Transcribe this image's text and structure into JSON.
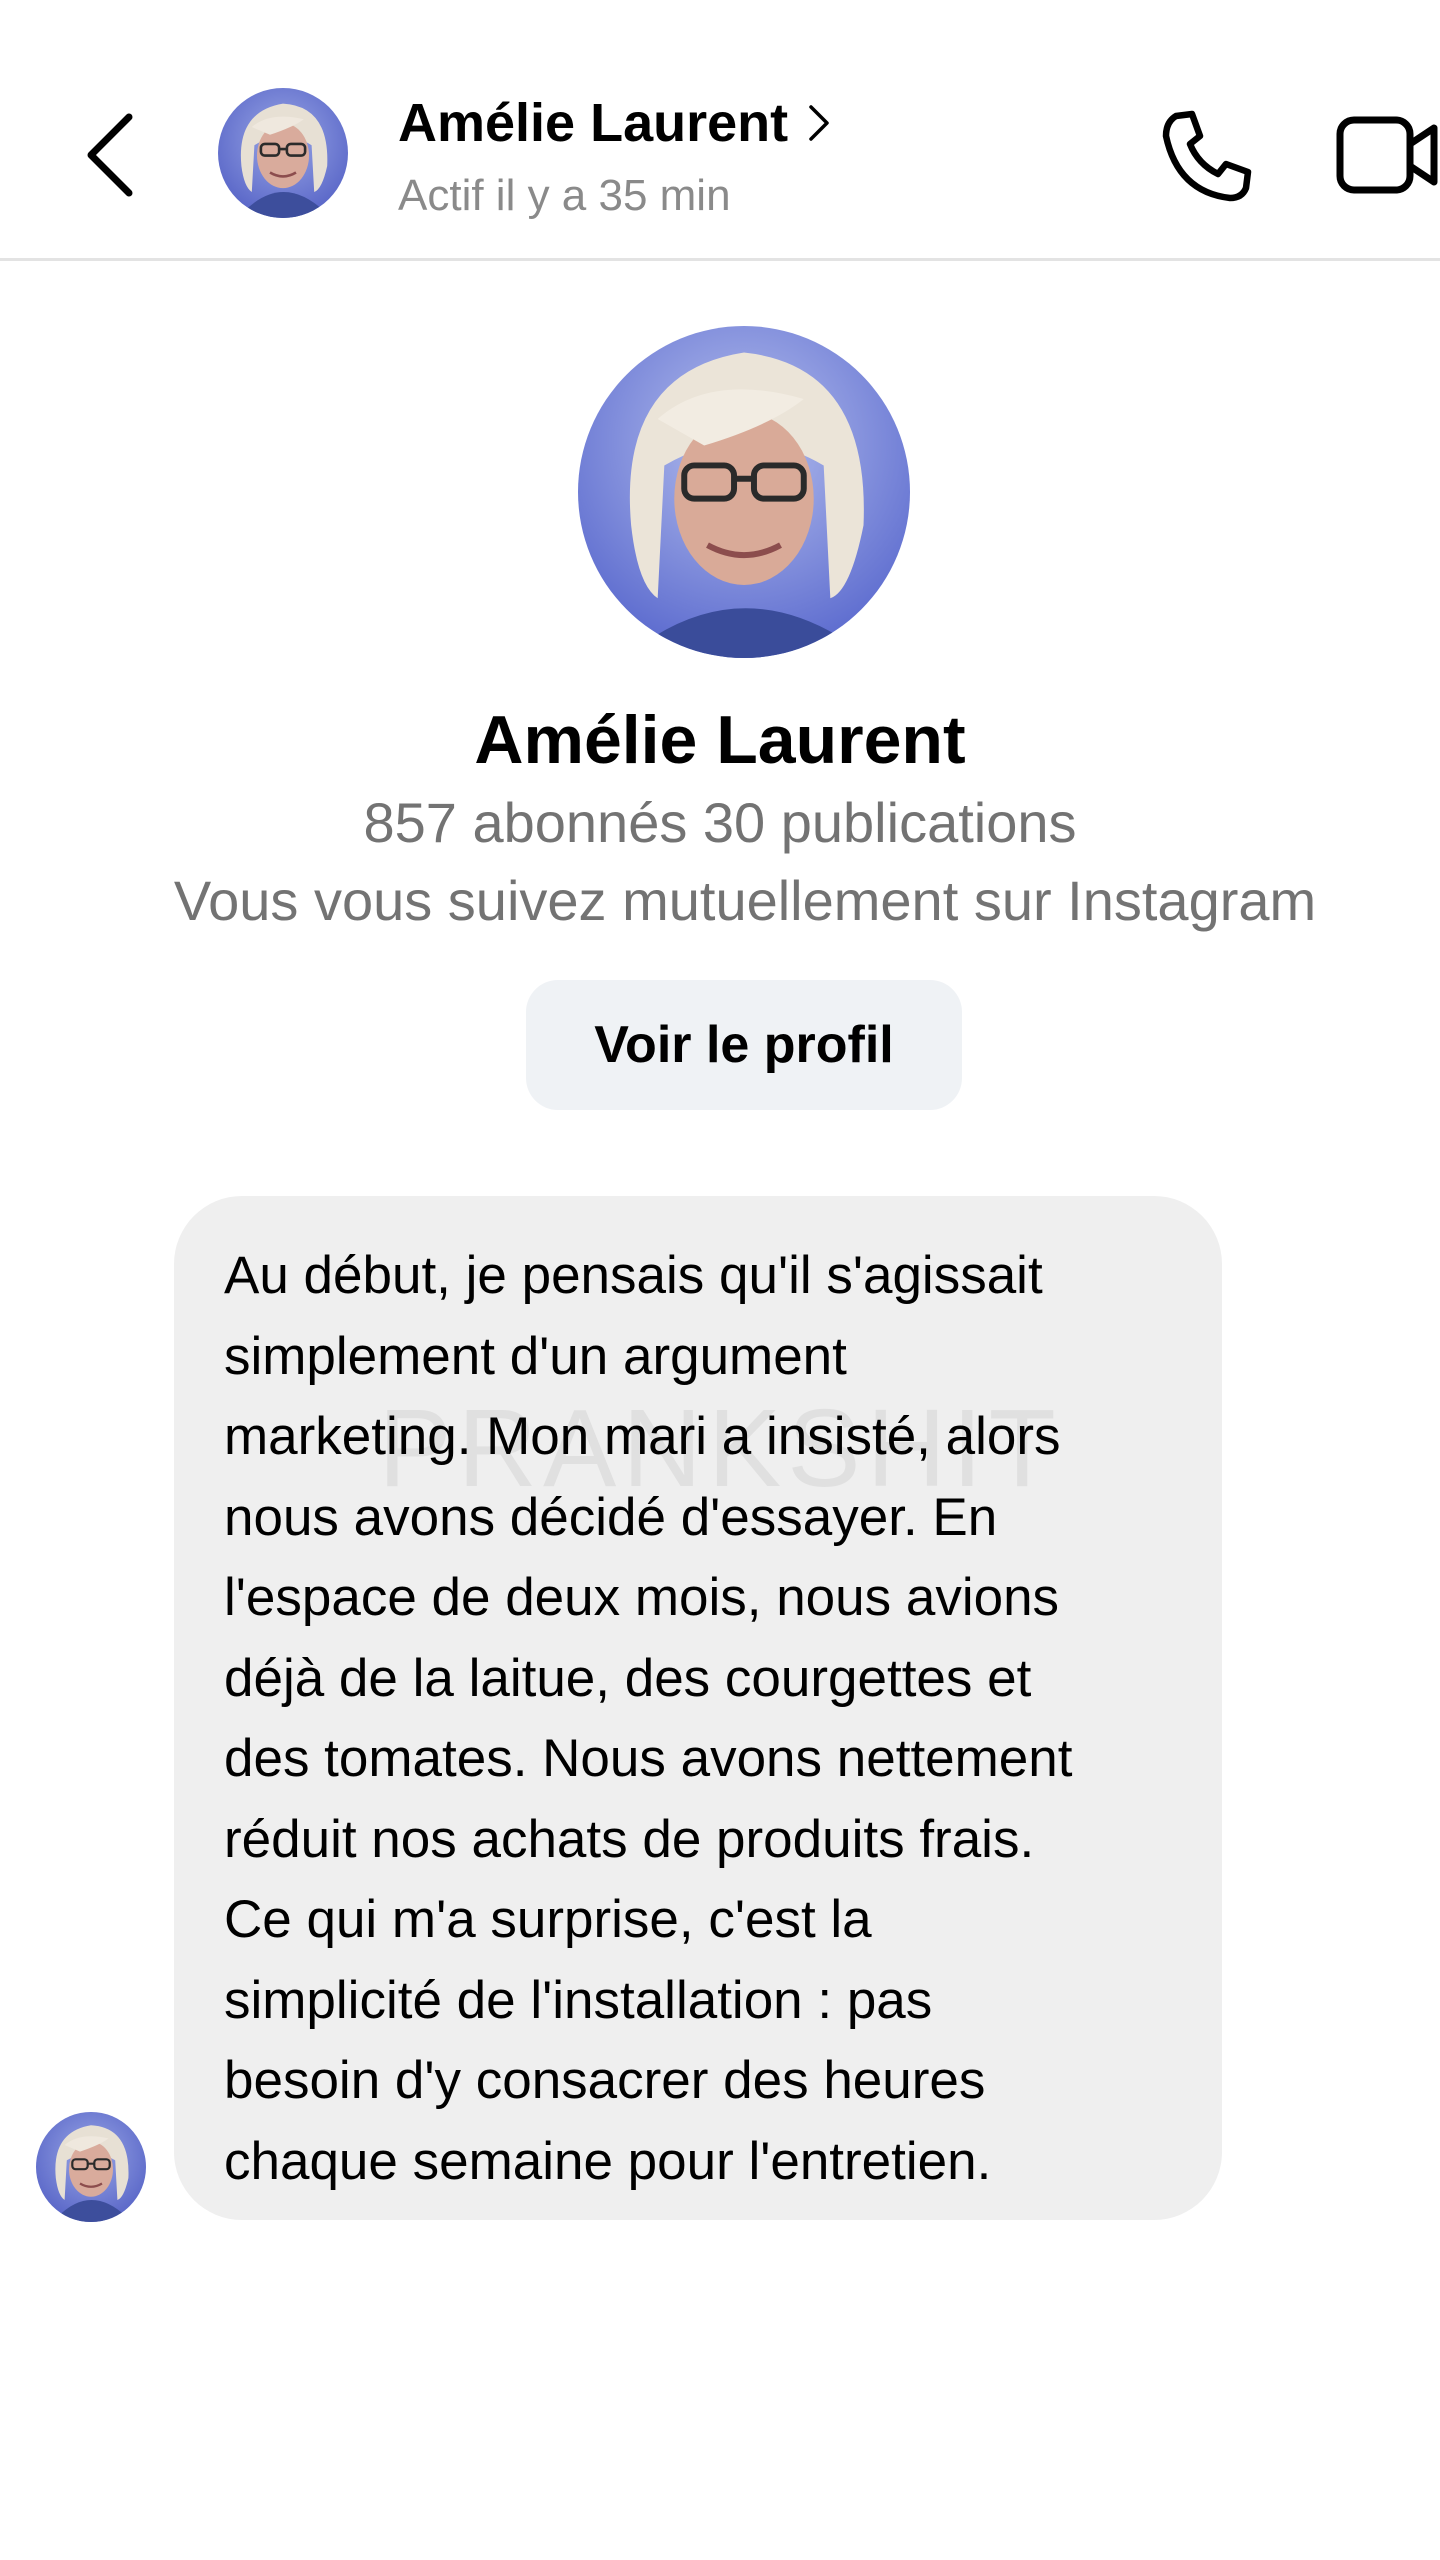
{
  "watermark": "PRANKSHIT",
  "header": {
    "contact_name": "Amélie Laurent",
    "status": "Actif il y a 35 min"
  },
  "profile": {
    "name": "Amélie Laurent",
    "stats": "857 abonnés 30 publications",
    "mutual": "Vous vous suivez mutuellement sur Instagram",
    "view_profile_label": "Voir le profil"
  },
  "message": {
    "lines": [
      "Au début, je pensais qu'il s'agissait",
      "simplement d'un argument",
      "marketing. Mon mari a insisté, alors",
      "nous avons décidé d'essayer. En",
      "l'espace de deux mois, nous avions",
      "déjà de la laitue, des courgettes et",
      "des tomates. Nous avons nettement",
      "réduit nos achats de produits frais.",
      "Ce qui m'a surprise, c'est la",
      "simplicité de l'installation : pas",
      "besoin d'y consacrer des heures",
      "chaque semaine pour l'entretien."
    ]
  },
  "icons": {
    "back": "chevron-left-icon",
    "chevron": "chevron-right-icon",
    "call": "phone-icon",
    "video": "video-camera-icon"
  }
}
